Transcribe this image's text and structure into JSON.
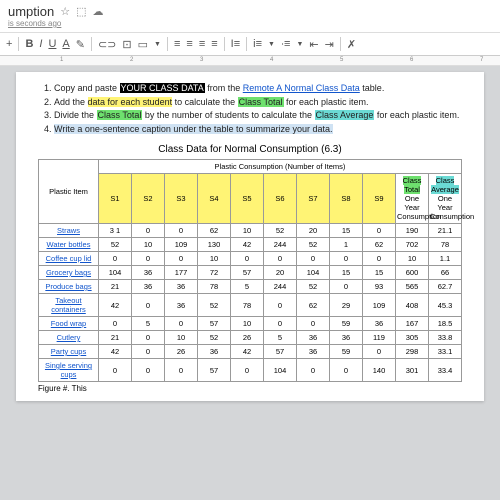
{
  "titlebar": {
    "name_suffix": "umption",
    "subtitle": "is seconds ago"
  },
  "toolbar": {
    "plus": "+",
    "bold": "B",
    "italic": "I",
    "underline": "U",
    "textcolor": "A",
    "highlight": "✎",
    "link": "⊂⊃",
    "image": "⊡",
    "comment": "▭",
    "alignL": "≡",
    "alignC": "≡",
    "alignR": "≡",
    "alignJ": "≡",
    "lineSpacing": "I≡",
    "listNum": "i≡",
    "listBul": "∙≡",
    "indentDec": "⇤",
    "indentInc": "⇥",
    "clear": "✗"
  },
  "ruler": {
    "m1": "1",
    "m2": "2",
    "m3": "3",
    "m4": "4",
    "m5": "5",
    "m6": "6",
    "m7": "7"
  },
  "instructions": {
    "i1a": "Copy and paste ",
    "i1b": "YOUR CLASS DATA",
    "i1c": " from the ",
    "i1d": "Remote A Normal Class Data",
    "i1e": " table.",
    "i2a": "Add the ",
    "i2b": "data for each student",
    "i2c": " to calculate the ",
    "i2d": "Class Total",
    "i2e": " for each plastic item.",
    "i3a": "Divide the ",
    "i3b": "Class Total",
    "i3c": " by the number of students to calculate the ",
    "i3d": "Class Average",
    "i3e": " for each plastic item.",
    "i4a": "Write a one-sentence caption under the table to summarize your data."
  },
  "table": {
    "title": "Class Data for Normal Consumption (6.3)",
    "header1": "Plastic Item",
    "header2": "Plastic Consumption (Number of Items)",
    "cols": {
      "s1": "S1",
      "s2": "S2",
      "s3": "S3",
      "s4": "S4",
      "s5": "S5",
      "s6": "S6",
      "s7": "S7",
      "s8": "S8",
      "s9": "S9"
    },
    "ctotal": "Class Total",
    "ctotal_sub": "One Year Consumption",
    "cavg": "Class Average",
    "cavg_sub": "One Year Consumption",
    "rows": [
      {
        "label": "Straws",
        "v": [
          "3 1",
          "0",
          "0",
          "62",
          "10",
          "52",
          "20",
          "15",
          "0"
        ],
        "total": "190",
        "avg": "21.1"
      },
      {
        "label": "Water bottles",
        "v": [
          "52",
          "10",
          "109",
          "130",
          "42",
          "244",
          "52",
          "1",
          "62"
        ],
        "total": "702",
        "avg": "78"
      },
      {
        "label": "Coffee cup lid",
        "v": [
          "0",
          "0",
          "0",
          "10",
          "0",
          "0",
          "0",
          "0",
          "0"
        ],
        "total": "10",
        "avg": "1.1"
      },
      {
        "label": "Grocery bags",
        "v": [
          "104",
          "36",
          "177",
          "72",
          "57",
          "20",
          "104",
          "15",
          "15"
        ],
        "total": "600",
        "avg": "66"
      },
      {
        "label": "Produce bags",
        "v": [
          "21",
          "36",
          "36",
          "78",
          "5",
          "244",
          "52",
          "0",
          "93"
        ],
        "total": "565",
        "avg": "62.7"
      },
      {
        "label": "Takeout containers",
        "v": [
          "42",
          "0",
          "36",
          "52",
          "78",
          "0",
          "62",
          "29",
          "109"
        ],
        "total": "408",
        "avg": "45.3"
      },
      {
        "label": "Food wrap",
        "v": [
          "0",
          "5",
          "0",
          "57",
          "10",
          "0",
          "0",
          "59",
          "36"
        ],
        "total": "167",
        "avg": "18.5"
      },
      {
        "label": "Cutlery",
        "v": [
          "21",
          "0",
          "10",
          "52",
          "26",
          "5",
          "36",
          "36",
          "119"
        ],
        "total": "305",
        "avg": "33.8"
      },
      {
        "label": "Party cups",
        "v": [
          "42",
          "0",
          "26",
          "36",
          "42",
          "57",
          "36",
          "59",
          "0"
        ],
        "total": "298",
        "avg": "33.1"
      },
      {
        "label": "Single serving cups",
        "v": [
          "0",
          "0",
          "0",
          "57",
          "0",
          "104",
          "0",
          "0",
          "140"
        ],
        "total": "301",
        "avg": "33.4"
      }
    ],
    "figure": "Figure #. This"
  }
}
